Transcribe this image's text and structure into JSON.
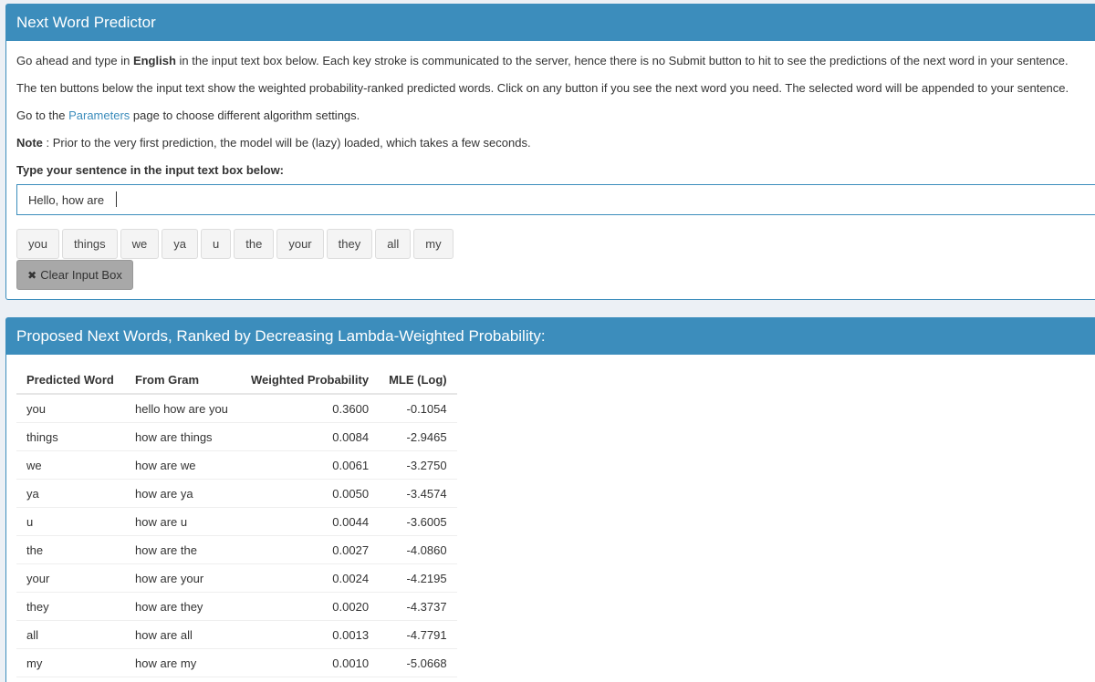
{
  "panel1": {
    "title": "Next Word Predictor",
    "intro_p1_before": "Go ahead and type in ",
    "intro_p1_bold": "English",
    "intro_p1_after": " in the input text box below. Each key stroke is communicated to the server, hence there is no Submit button to hit to see the predictions of the next word in your sentence.",
    "intro_p2": "The ten buttons below the input text show the weighted probability-ranked predicted words. Click on any button if you see the next word you need. The selected word will be appended to your sentence.",
    "intro_p3_before": "Go to the ",
    "intro_p3_link": "Parameters",
    "intro_p3_after": " page to choose different algorithm settings.",
    "note_label": "Note",
    "note_text": " : Prior to the very first prediction, the model will be (lazy) loaded, which takes a few seconds.",
    "input_label": "Type your sentence in the input text box below:",
    "input_value": "Hello, how are ",
    "word_buttons": [
      "you",
      "things",
      "we",
      "ya",
      "u",
      "the",
      "your",
      "they",
      "all",
      "my"
    ],
    "clear_icon": "✖",
    "clear_label": "Clear Input Box"
  },
  "panel2": {
    "title": "Proposed Next Words, Ranked by Decreasing Lambda-Weighted Probability:",
    "columns": [
      "Predicted Word",
      "From Gram",
      "Weighted Probability",
      "MLE (Log)"
    ],
    "rows": [
      [
        "you",
        "hello how are you",
        "0.3600",
        "-0.1054"
      ],
      [
        "things",
        "how are things",
        "0.0084",
        "-2.9465"
      ],
      [
        "we",
        "how are we",
        "0.0061",
        "-3.2750"
      ],
      [
        "ya",
        "how are ya",
        "0.0050",
        "-3.4574"
      ],
      [
        "u",
        "how are u",
        "0.0044",
        "-3.6005"
      ],
      [
        "the",
        "how are the",
        "0.0027",
        "-4.0860"
      ],
      [
        "your",
        "how are your",
        "0.0024",
        "-4.2195"
      ],
      [
        "they",
        "how are they",
        "0.0020",
        "-4.3737"
      ],
      [
        "all",
        "how are all",
        "0.0013",
        "-4.7791"
      ],
      [
        "my",
        "how are my",
        "0.0010",
        "-5.0668"
      ]
    ]
  },
  "colors": {
    "primary": "#3c8dbc",
    "background": "#ecf0f5",
    "button": "#f4f4f4",
    "clear_button": "#a8a8a8"
  }
}
